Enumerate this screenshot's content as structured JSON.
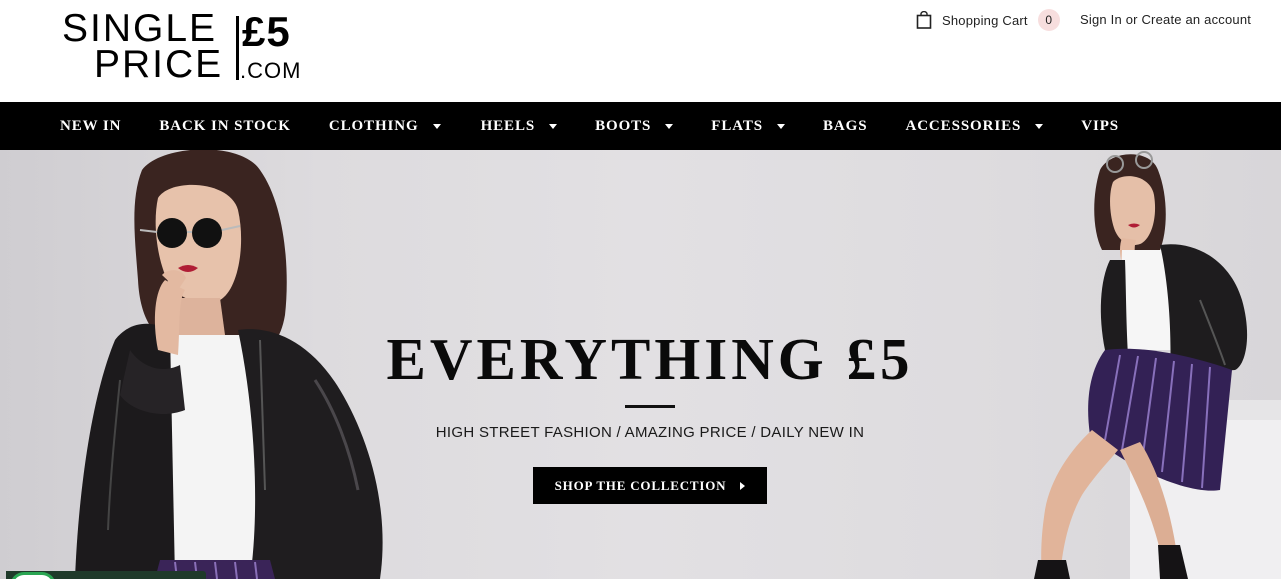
{
  "logo": {
    "line1": "SINGLE",
    "line2": "PRICE",
    "price": "£5",
    "domain": ".COM"
  },
  "header": {
    "cart_label": "Shopping Cart",
    "cart_count": "0",
    "sign_in": "Sign In",
    "or_text": "or",
    "create_account": "Create an account"
  },
  "nav": {
    "items": [
      {
        "label": "NEW IN",
        "dropdown": false
      },
      {
        "label": "BACK IN STOCK",
        "dropdown": false
      },
      {
        "label": "CLOTHING",
        "dropdown": true
      },
      {
        "label": "HEELS",
        "dropdown": true
      },
      {
        "label": "BOOTS",
        "dropdown": true
      },
      {
        "label": "FLATS",
        "dropdown": true
      },
      {
        "label": "BAGS",
        "dropdown": false
      },
      {
        "label": "ACCESSORIES",
        "dropdown": true
      },
      {
        "label": "VIPS",
        "dropdown": false
      }
    ]
  },
  "hero": {
    "title": "EVERYTHING £5",
    "subtitle": "HIGH STREET FASHION / AMAZING PRICE / DAILY NEW IN",
    "cta_label": "SHOP THE COLLECTION"
  },
  "icons": {
    "cart": "shopping-bag-icon",
    "dropdown": "caret-down-icon",
    "cta": "caret-right-icon",
    "chat": "whatsapp-icon"
  },
  "colors": {
    "nav_background": "#000000",
    "nav_text": "#ffffff",
    "cart_badge": "#f7dede",
    "hero_background": "#dedcdf",
    "button_background": "#000000"
  }
}
